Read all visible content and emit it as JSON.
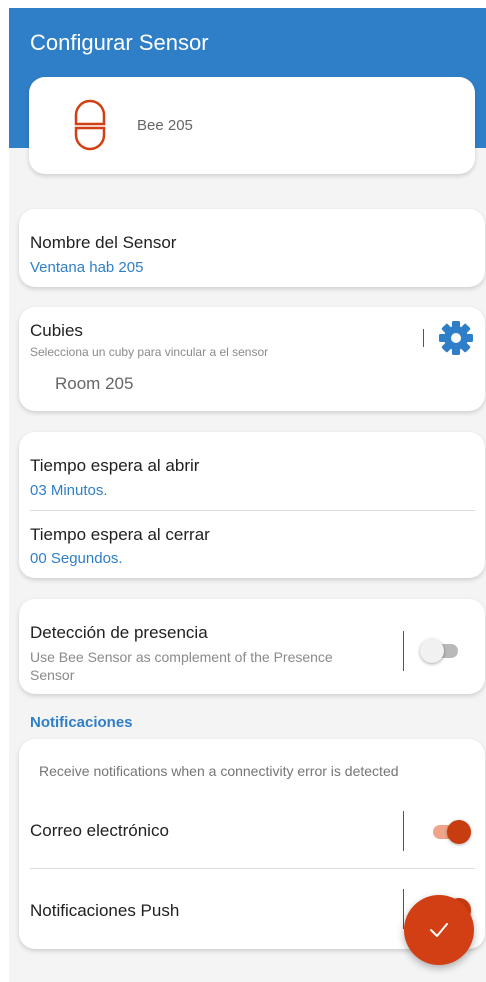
{
  "header": {
    "title": "Configurar Sensor"
  },
  "device": {
    "name": "Bee 205",
    "icon": "door-sensor-icon"
  },
  "sensor_name": {
    "label": "Nombre del Sensor",
    "value": "Ventana hab 205"
  },
  "cubies": {
    "label": "Cubies",
    "hint": "Selecciona un cuby para vincular a el sensor",
    "value": "Room 205",
    "icon": "gear-icon"
  },
  "timers": {
    "open": {
      "label": "Tiempo espera al abrir",
      "value": "03 Minutos."
    },
    "close": {
      "label": "Tiempo espera al cerrar",
      "value": "00 Segundos."
    }
  },
  "presence": {
    "label": "Detección de presencia",
    "description": "Use Bee Sensor as complement of the Presence Sensor",
    "enabled": false
  },
  "notifications": {
    "section_title": "Notificaciones",
    "description": "Receive notifications when a connectivity error is detected",
    "email": {
      "label": "Correo electrónico",
      "enabled": true
    },
    "push": {
      "label": "Notificaciones Push",
      "enabled": true
    }
  },
  "fab": {
    "icon": "check-icon"
  },
  "colors": {
    "primary": "#2f7fc8",
    "accent": "#d23f14",
    "background": "#f4f4f4"
  }
}
